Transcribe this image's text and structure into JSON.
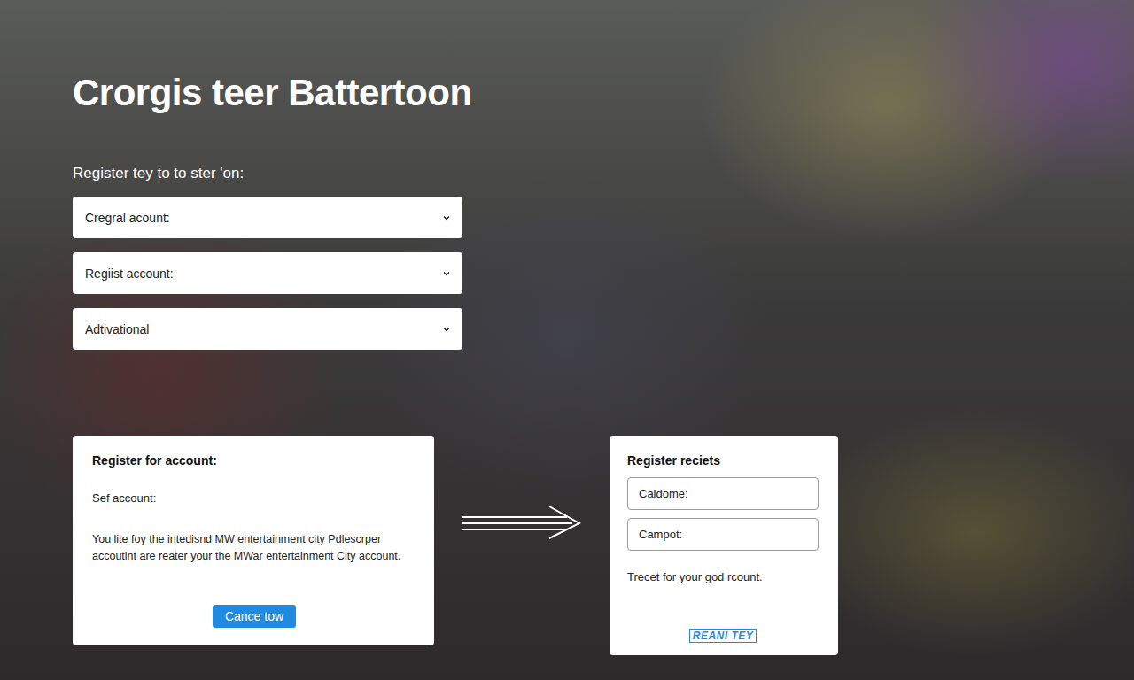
{
  "page": {
    "title": "Crorgis teer Battertoon",
    "subtitle": "Register tey to to ster 'on:"
  },
  "dropdowns": [
    {
      "label": "Cregral acount:"
    },
    {
      "label": "Regiist account:"
    },
    {
      "label": "Adtivational"
    }
  ],
  "register_card": {
    "title": "Register for account:",
    "label": "Sef account:",
    "body": "You lite foy the intedisnd MW entertainment city Pdlescrper accoutint are reater your the MWar entertainment City account.",
    "button": "Cance tow"
  },
  "receipts_card": {
    "title": "Register reciets",
    "fields": [
      {
        "label": "Caldome:"
      },
      {
        "label": "Campot:"
      }
    ],
    "note": "Trecet for your god rcount.",
    "link": "REANI TEY"
  }
}
